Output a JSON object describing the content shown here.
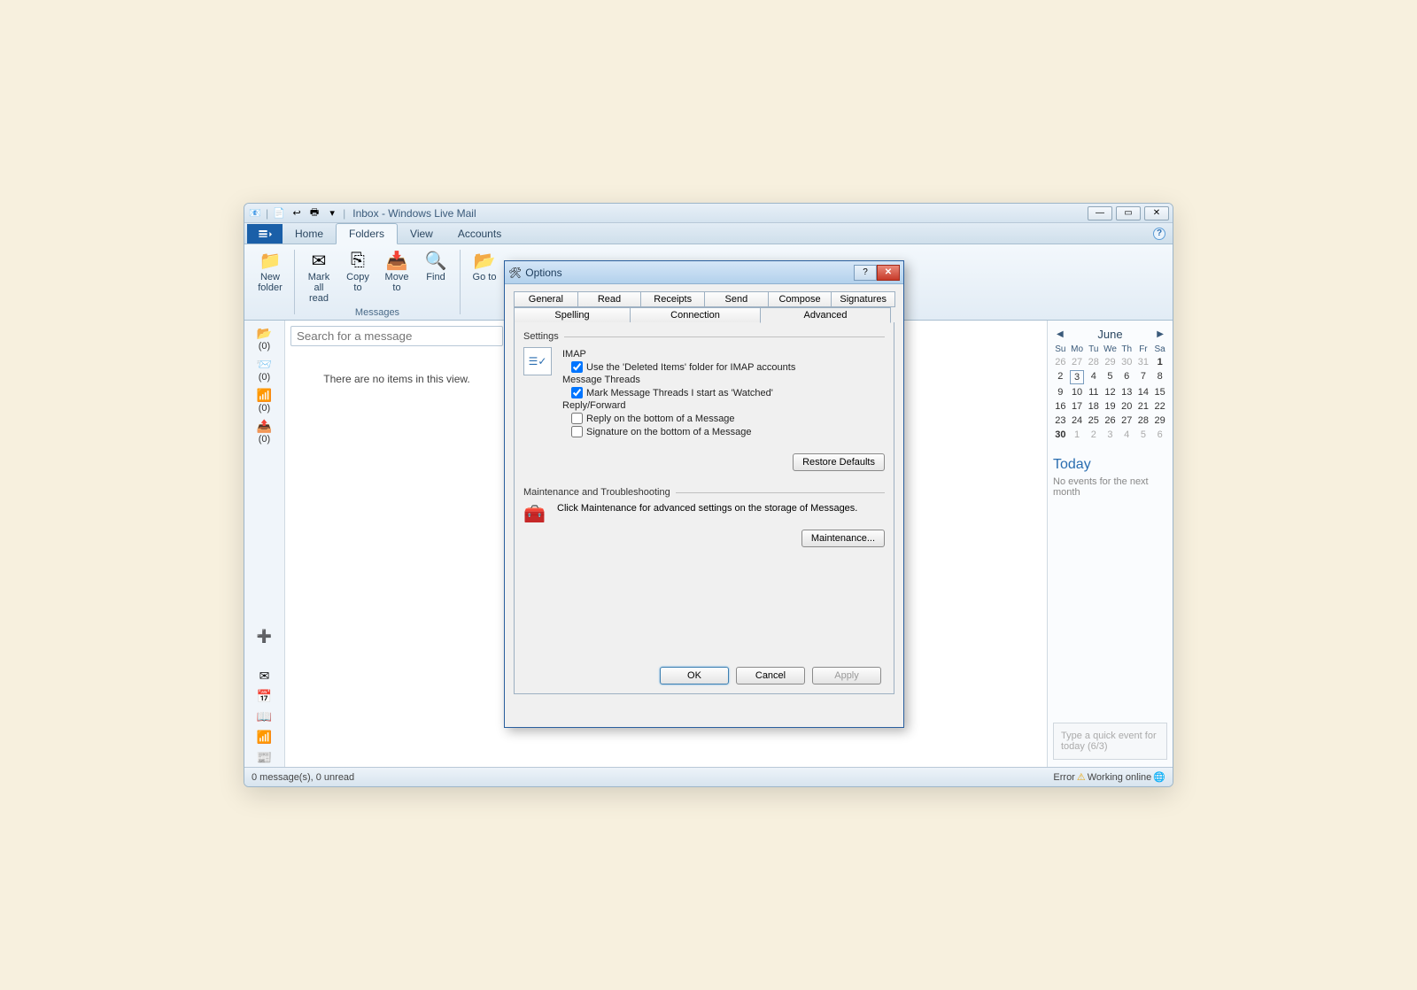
{
  "titlebar": {
    "title": "Inbox - Windows Live Mail"
  },
  "ribbon": {
    "tabs": {
      "home": "Home",
      "folders": "Folders",
      "view": "View",
      "accounts": "Accounts"
    },
    "buttons": {
      "new_folder": "New\nfolder",
      "mark_all_read": "Mark\nall read",
      "copy_to": "Copy\nto",
      "move_to": "Move\nto",
      "find": "Find",
      "go_to": "Go to"
    },
    "group_messages": "Messages"
  },
  "search": {
    "placeholder": "Search for a message"
  },
  "nav": {
    "counts": [
      "(0)",
      "(0)",
      "(0)",
      "(0)"
    ]
  },
  "content": {
    "empty": "There are no items in this view."
  },
  "calendar": {
    "month": "June",
    "dow": [
      "Su",
      "Mo",
      "Tu",
      "We",
      "Th",
      "Fr",
      "Sa"
    ],
    "weeks": [
      [
        {
          "d": "26",
          "o": true
        },
        {
          "d": "27",
          "o": true
        },
        {
          "d": "28",
          "o": true
        },
        {
          "d": "29",
          "o": true
        },
        {
          "d": "30",
          "o": true
        },
        {
          "d": "31",
          "o": true
        },
        {
          "d": "1",
          "b": true
        }
      ],
      [
        {
          "d": "2"
        },
        {
          "d": "3",
          "today": true
        },
        {
          "d": "4"
        },
        {
          "d": "5"
        },
        {
          "d": "6"
        },
        {
          "d": "7"
        },
        {
          "d": "8"
        }
      ],
      [
        {
          "d": "9"
        },
        {
          "d": "10"
        },
        {
          "d": "11"
        },
        {
          "d": "12"
        },
        {
          "d": "13"
        },
        {
          "d": "14"
        },
        {
          "d": "15"
        }
      ],
      [
        {
          "d": "16"
        },
        {
          "d": "17"
        },
        {
          "d": "18"
        },
        {
          "d": "19"
        },
        {
          "d": "20"
        },
        {
          "d": "21"
        },
        {
          "d": "22"
        }
      ],
      [
        {
          "d": "23"
        },
        {
          "d": "24"
        },
        {
          "d": "25"
        },
        {
          "d": "26"
        },
        {
          "d": "27"
        },
        {
          "d": "28"
        },
        {
          "d": "29"
        }
      ],
      [
        {
          "d": "30",
          "b": true
        },
        {
          "d": "1",
          "o": true
        },
        {
          "d": "2",
          "o": true
        },
        {
          "d": "3",
          "o": true
        },
        {
          "d": "4",
          "o": true
        },
        {
          "d": "5",
          "o": true
        },
        {
          "d": "6",
          "o": true
        }
      ]
    ],
    "today_heading": "Today",
    "no_events": "No events for the next month",
    "quick_event_placeholder": "Type a quick event for today (6/3)"
  },
  "status": {
    "left": "0 message(s), 0 unread",
    "error": "Error",
    "online": "Working online"
  },
  "dialog": {
    "title": "Options",
    "tabs": {
      "general": "General",
      "read": "Read",
      "receipts": "Receipts",
      "send": "Send",
      "compose": "Compose",
      "signatures": "Signatures",
      "spelling": "Spelling",
      "connection": "Connection",
      "advanced": "Advanced"
    },
    "settings_heading": "Settings",
    "imap_label": "IMAP",
    "imap_check": "Use the 'Deleted Items' folder for IMAP accounts",
    "threads_label": "Message Threads",
    "threads_check": "Mark Message Threads I start as 'Watched'",
    "reply_label": "Reply/Forward",
    "reply_check": "Reply on the bottom of a Message",
    "sig_check": "Signature on the bottom of a Message",
    "restore": "Restore Defaults",
    "maint_heading": "Maintenance and Troubleshooting",
    "maint_text": "Click Maintenance for advanced settings on the storage of Messages.",
    "maint_button": "Maintenance...",
    "ok": "OK",
    "cancel": "Cancel",
    "apply": "Apply"
  }
}
